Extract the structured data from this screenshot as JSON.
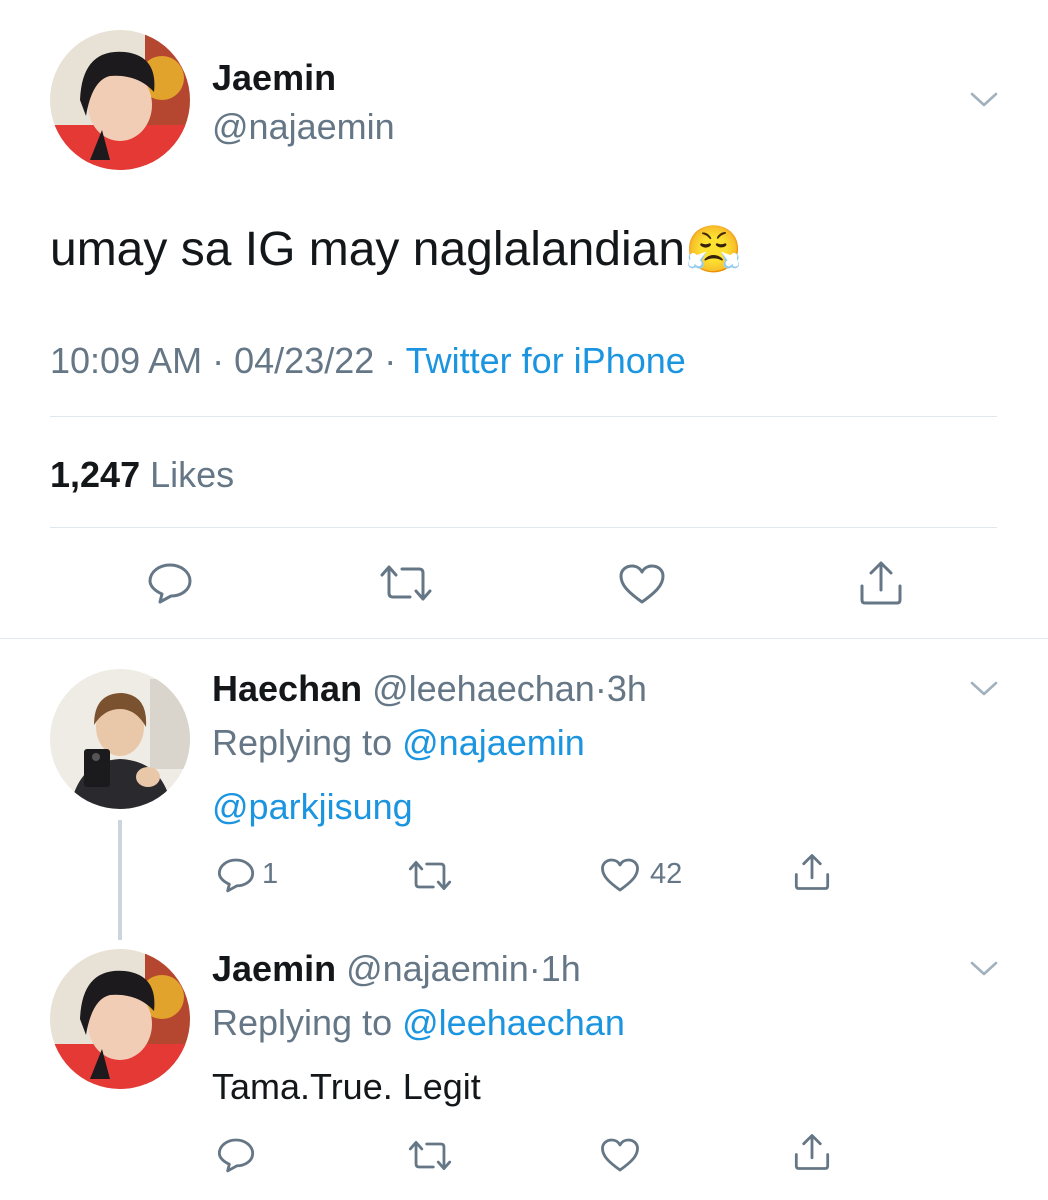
{
  "main_tweet": {
    "name": "Jaemin",
    "handle": "@najaemin",
    "text": "umay sa IG may naglalandian",
    "emoji": "😤",
    "time": "10:09 AM",
    "sep1": "·",
    "date": "04/23/22",
    "sep2": "·",
    "source": "Twitter for iPhone",
    "likes_count": "1,247",
    "likes_label": "Likes"
  },
  "replies": [
    {
      "name": "Haechan",
      "handle": "@leehaechan",
      "sep": "·",
      "time": "3h",
      "replying_label": "Replying to",
      "replying_to": "@najaemin",
      "text": "@parkjisung",
      "reply_count": "1",
      "like_count": "42"
    },
    {
      "name": "Jaemin",
      "handle": "@najaemin",
      "sep": "·",
      "time": "1h",
      "replying_label": "Replying to",
      "replying_to": "@leehaechan",
      "text": "Tama.True. Legit"
    }
  ],
  "colors": {
    "accent": "#1b95e0",
    "secondary_text": "#657786",
    "divider": "#e1e8ed",
    "icon": "#657786"
  },
  "icons": [
    "chevron-down-icon",
    "reply-icon",
    "retweet-icon",
    "like-icon",
    "share-icon"
  ]
}
